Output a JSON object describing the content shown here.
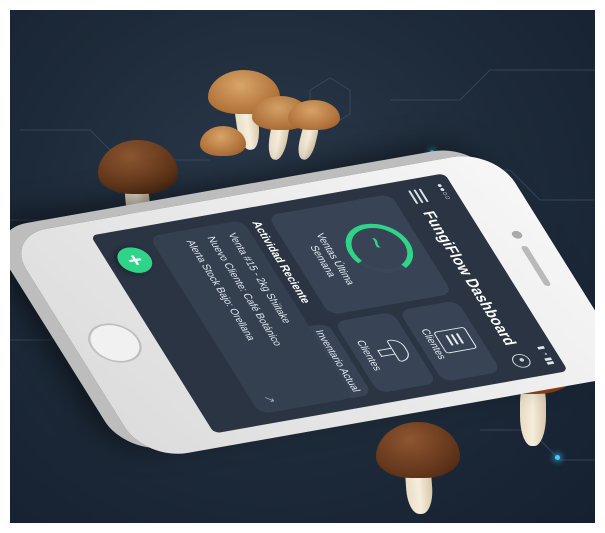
{
  "app": {
    "title": "FungiFlow Dashboard",
    "status_left": "●●○○",
    "status_right": "▮ ◔ ▮▮"
  },
  "cards": {
    "sales_label": "Ventas Última Semana",
    "clients_label_1": "Clientes",
    "clients_label_2": "Clientes",
    "inventory_label": "Inventario Actual"
  },
  "activity": {
    "title": "Actividad Reciente",
    "items": [
      "Venta #15 - 2kg Shiitake",
      "Nuevo Cliente: Café Botánico",
      "Alerta Stock Bajo: Orellana"
    ],
    "more_symbol": "↗"
  },
  "fab": {
    "symbol": "+"
  },
  "icons": {
    "menu": "hamburger-menu-icon",
    "settings": "settings-icon",
    "sales": "trend-ring-icon",
    "clients": "document-icon",
    "clients2": "mushroom-icon"
  },
  "colors": {
    "accent": "#2fd489",
    "screen_bg": "#2a3442",
    "card_bg": "#384456",
    "background": "#1d2a39"
  }
}
